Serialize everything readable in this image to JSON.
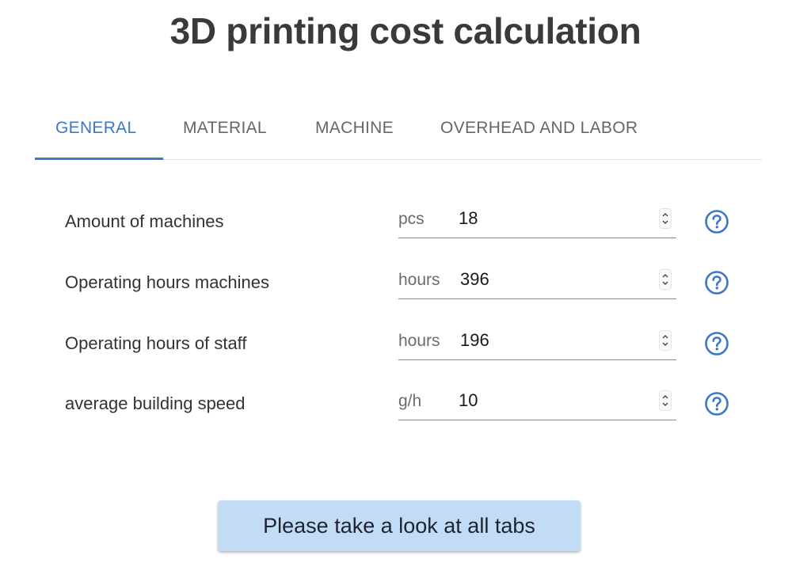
{
  "page": {
    "title": "3D printing cost calculation"
  },
  "colors": {
    "accent": "#3d78c8",
    "button_bg": "#c3dcf5"
  },
  "tabs": [
    {
      "label": "GENERAL",
      "active": true
    },
    {
      "label": "MATERIAL",
      "active": false
    },
    {
      "label": "MACHINE",
      "active": false
    },
    {
      "label": "OVERHEAD AND LABOR",
      "active": false
    }
  ],
  "fields": [
    {
      "label": "Amount of machines",
      "unit": "pcs",
      "value": "18",
      "icon": "help-icon"
    },
    {
      "label": "Operating hours machines",
      "unit": "hours",
      "value": "396",
      "icon": "help-icon"
    },
    {
      "label": "Operating hours of staff",
      "unit": "hours",
      "value": "196",
      "icon": "help-icon"
    },
    {
      "label": "average building speed",
      "unit": "g/h",
      "value": "10",
      "icon": "help-icon"
    }
  ],
  "cta": {
    "label": "Please take a look at all tabs"
  }
}
